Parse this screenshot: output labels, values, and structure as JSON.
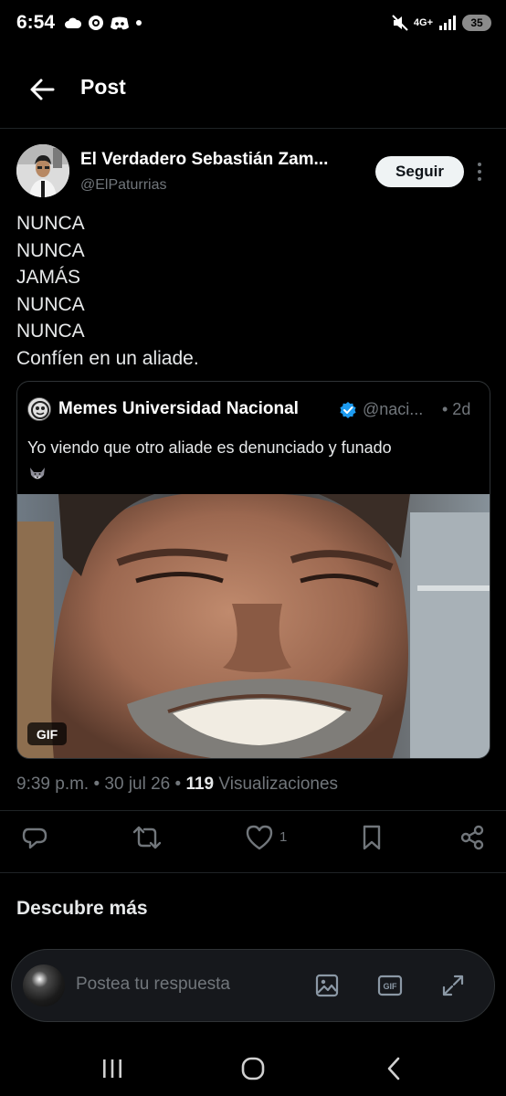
{
  "status_bar": {
    "time": "6:54",
    "network": "4G+",
    "battery": "35"
  },
  "header": {
    "title": "Post"
  },
  "post": {
    "author_name": "El Verdadero Sebastián Zam...",
    "author_handle": "@ElPaturrias",
    "follow_label": "Seguir",
    "text_lines": [
      "NUNCA",
      "NUNCA",
      "JAMÁS",
      "NUNCA",
      "NUNCA",
      "Confíen en un aliade."
    ],
    "quote": {
      "name": "Memes Universidad Nacional",
      "handle": "@naci...",
      "time": "• 2d",
      "text": "Yo viendo que otro aliade es denunciado y funado",
      "media_badge": "GIF"
    },
    "timestamp": "9:39 p.m. • 30 jul 26 • ",
    "views_count": "119",
    "views_label": " Visualizaciones",
    "like_count": "1"
  },
  "discover": {
    "title": "Descubre más"
  },
  "reply": {
    "placeholder": "Postea tu respuesta",
    "gif_label": "GIF"
  },
  "colors": {
    "accent": "#1d9bf0",
    "muted": "#71767b",
    "text": "#e7e9ea",
    "background": "#000000"
  }
}
